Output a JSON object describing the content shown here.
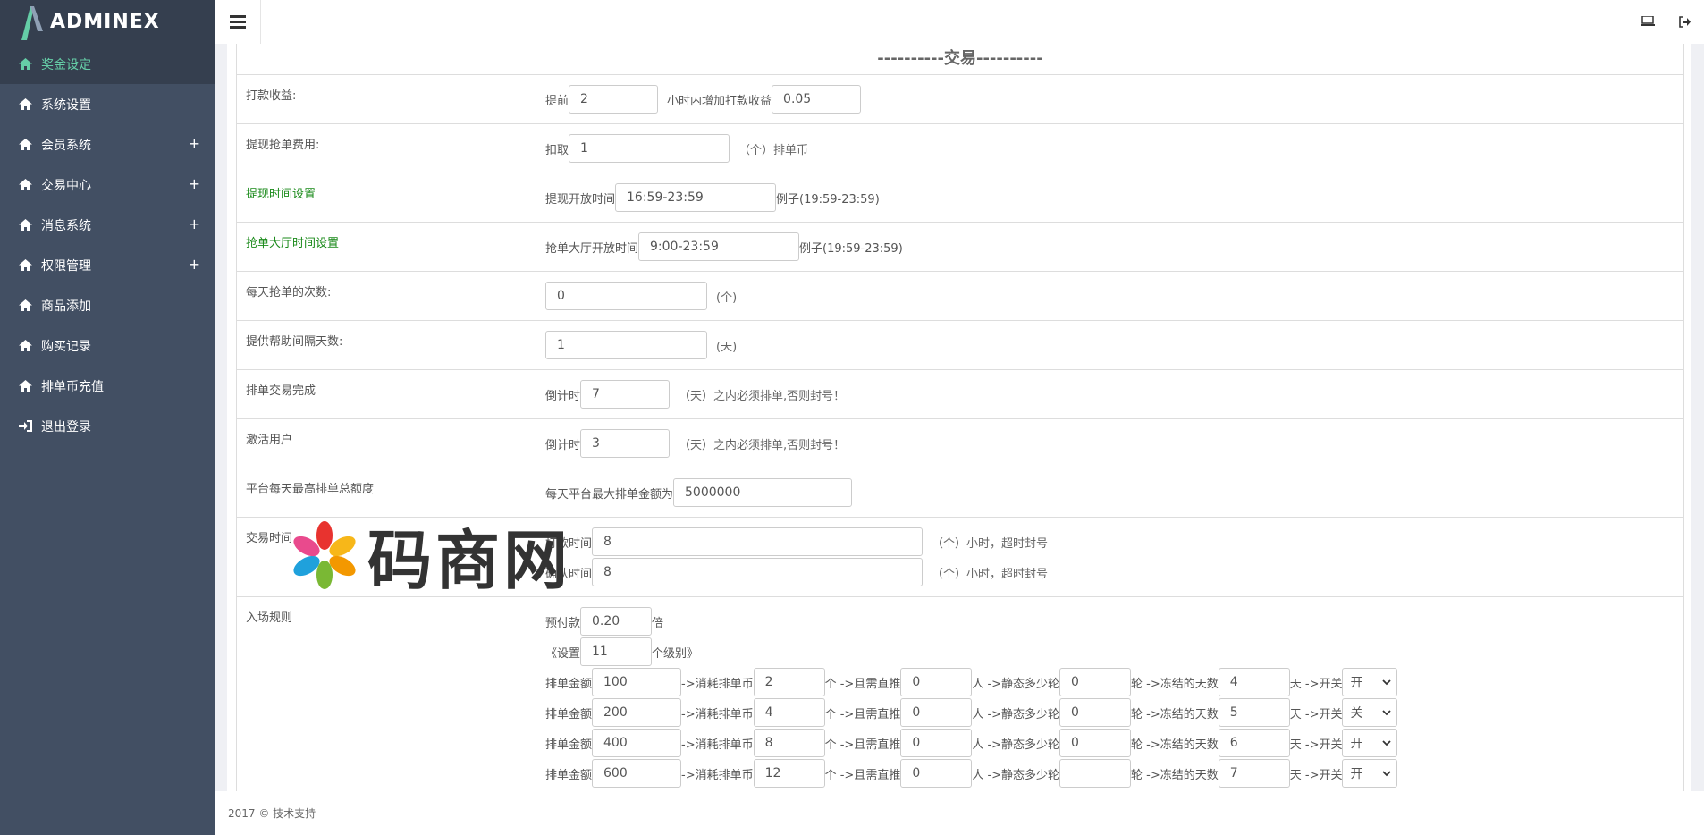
{
  "brand": {
    "name": "ADMINEX"
  },
  "sidebar": {
    "items": [
      {
        "label": "奖金设定",
        "active": true,
        "expandable": false
      },
      {
        "label": "系统设置",
        "active": false,
        "expandable": false
      },
      {
        "label": "会员系统",
        "active": false,
        "expandable": true
      },
      {
        "label": "交易中心",
        "active": false,
        "expandable": true
      },
      {
        "label": "消息系统",
        "active": false,
        "expandable": true
      },
      {
        "label": "权限管理",
        "active": false,
        "expandable": true
      },
      {
        "label": "商品添加",
        "active": false,
        "expandable": false
      },
      {
        "label": "购买记录",
        "active": false,
        "expandable": false
      },
      {
        "label": "排单币充值",
        "active": false,
        "expandable": false
      },
      {
        "label": "退出登录",
        "active": false,
        "expandable": false
      }
    ],
    "plus": "+"
  },
  "section_title": "----------交易----------",
  "form": {
    "payout": {
      "label": "打款收益:",
      "prefix": "提前",
      "hours": "2",
      "middle": "小时内增加打款收益",
      "rate": "0.05"
    },
    "withdraw_fee": {
      "label": "提现抢单费用:",
      "prefix": "扣取",
      "value": "1",
      "unit": "（个）排单币"
    },
    "withdraw_time": {
      "label": "提现时间设置",
      "prefix": "提现开放时间",
      "value": "16:59-23:59",
      "example": "例子(19:59-23:59)"
    },
    "hall_time": {
      "label": "抢单大厅时间设置",
      "prefix": "抢单大厅开放时间",
      "value": "9:00-23:59",
      "example": "例子(19:59-23:59)"
    },
    "daily_grabs": {
      "label": "每天抢单的次数:",
      "value": "0",
      "unit": "(个)"
    },
    "help_interval": {
      "label": "提供帮助间隔天数:",
      "value": "1",
      "unit": "(天)"
    },
    "queue_complete": {
      "label": "排单交易完成",
      "prefix": "倒计时",
      "value": "7",
      "unit": "（天）之内必须排单,否则封号！"
    },
    "activate": {
      "label": "激活用户",
      "prefix": "倒计时",
      "value": "3",
      "unit": "（天）之内必须排单,否则封号！"
    },
    "platform_max": {
      "label": "平台每天最高排单总额度",
      "prefix": "每天平台最大排单金额为",
      "value": "5000000"
    },
    "trade_time": {
      "label": "交易时间",
      "pay_prefix": "打款时间",
      "pay_value": "8",
      "pay_unit": "（个）小时，超时封号",
      "confirm_prefix": "确认时间",
      "confirm_value": "8",
      "confirm_unit": "（个）小时，超时封号"
    },
    "entry_rules": {
      "label": "入场规则",
      "prepay_prefix": "预付款",
      "prepay_value": "0.20",
      "prepay_unit": "倍",
      "levels_prefix": "《设置",
      "levels_value": "11",
      "levels_unit": "个级别》",
      "t_amount": "排单金额",
      "t_coin": "->消耗排单币",
      "t_ge": "个 ->且需直推",
      "t_ren": "人 ->静态多少轮",
      "t_lun": "轮 ->冻结的天数",
      "t_tian": "天 ->开关",
      "rows": [
        {
          "amount": "100",
          "coin": "2",
          "direct": "0",
          "rounds": "0",
          "days": "4",
          "switch": "开"
        },
        {
          "amount": "200",
          "coin": "4",
          "direct": "0",
          "rounds": "0",
          "days": "5",
          "switch": "关"
        },
        {
          "amount": "400",
          "coin": "8",
          "direct": "0",
          "rounds": "0",
          "days": "6",
          "switch": "开"
        },
        {
          "amount": "600",
          "coin": "12",
          "direct": "0",
          "rounds": "",
          "days": "7",
          "switch": "开"
        }
      ]
    }
  },
  "watermark": "码商网",
  "footer": "2017 © 技术支持",
  "colors": {
    "sidebar": "#424f63",
    "sidebar_dark": "#353f4f",
    "accent": "#65cea7",
    "green_label": "#1a8a1a"
  }
}
